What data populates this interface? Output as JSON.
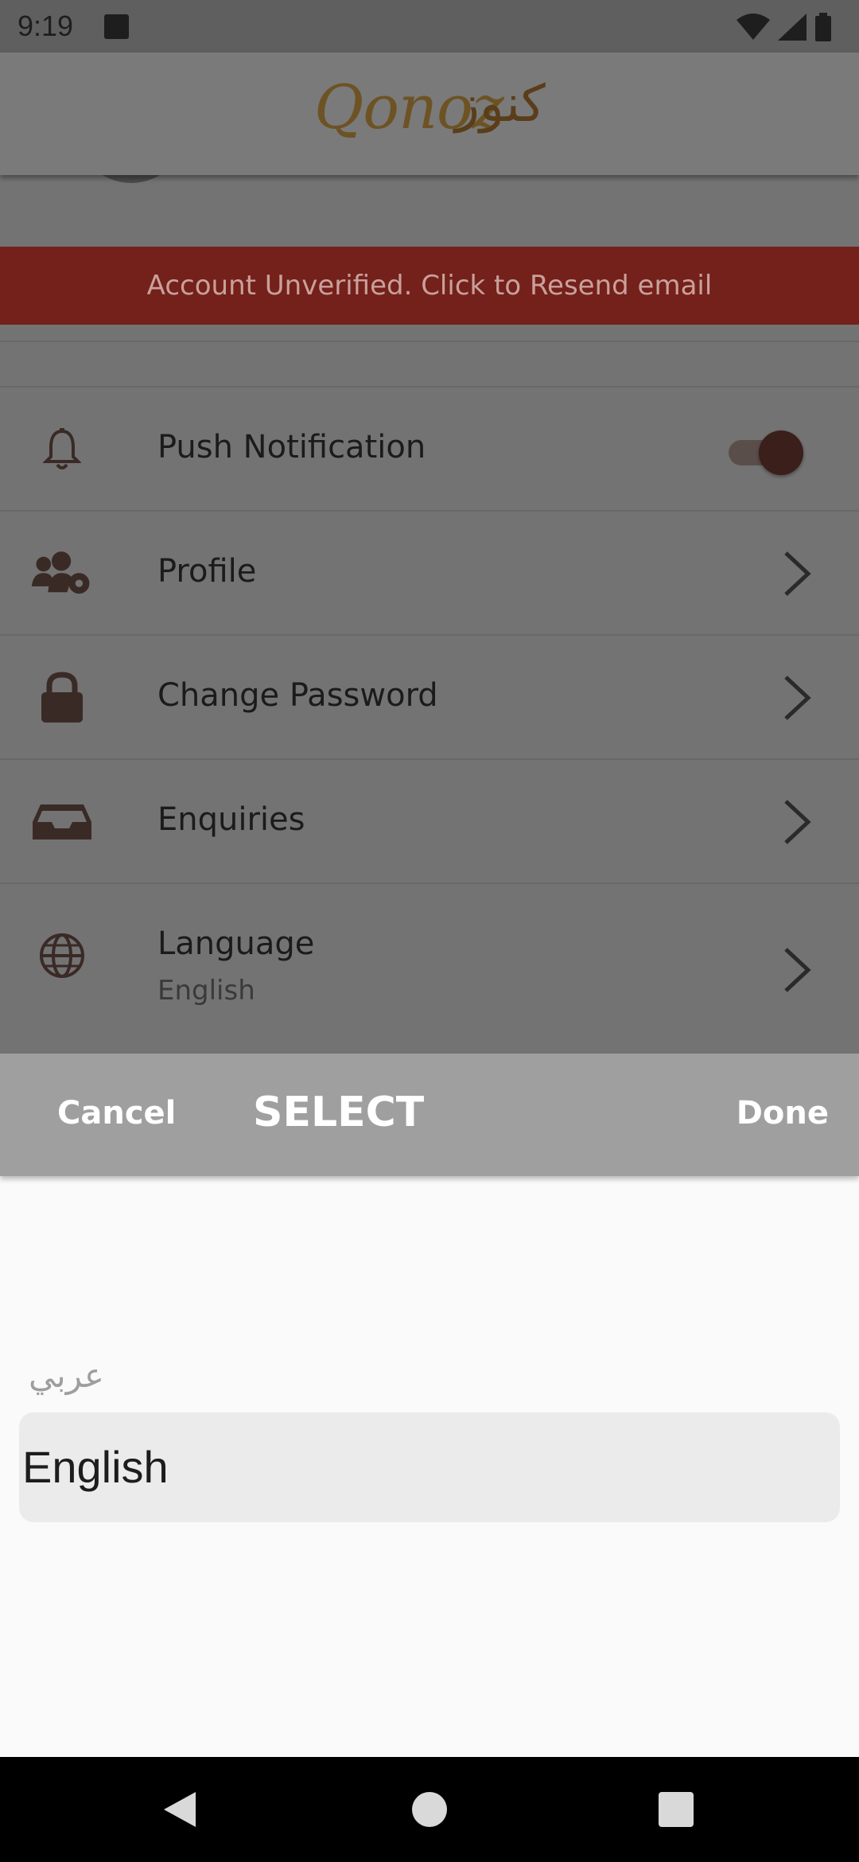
{
  "status_bar": {
    "time": "9:19",
    "icons": [
      "stop-square-icon",
      "wifi-icon",
      "signal-icon",
      "battery-icon"
    ]
  },
  "header": {
    "logo_latin": "Qonoz",
    "logo_arabic": "كنوز"
  },
  "banner": {
    "text": "Account Unverified. Click to Resend email",
    "color": "#74201b"
  },
  "settings": {
    "items": [
      {
        "label": "Push Notification",
        "icon": "bell-icon",
        "control": "toggle",
        "toggle_on": true
      },
      {
        "label": "Profile",
        "icon": "users-gear-icon",
        "control": "chevron"
      },
      {
        "label": "Change Password",
        "icon": "lock-icon",
        "control": "chevron"
      },
      {
        "label": "Enquiries",
        "icon": "inbox-icon",
        "control": "chevron"
      },
      {
        "label": "Language",
        "sublabel": "English",
        "icon": "globe-icon",
        "control": "chevron"
      }
    ]
  },
  "picker": {
    "cancel_label": "Cancel",
    "title": "SELECT",
    "done_label": "Done",
    "options": [
      "عربي",
      "English"
    ],
    "selected": "English"
  },
  "nav_bar": {
    "buttons": [
      "back-icon",
      "home-icon",
      "recents-icon"
    ]
  }
}
